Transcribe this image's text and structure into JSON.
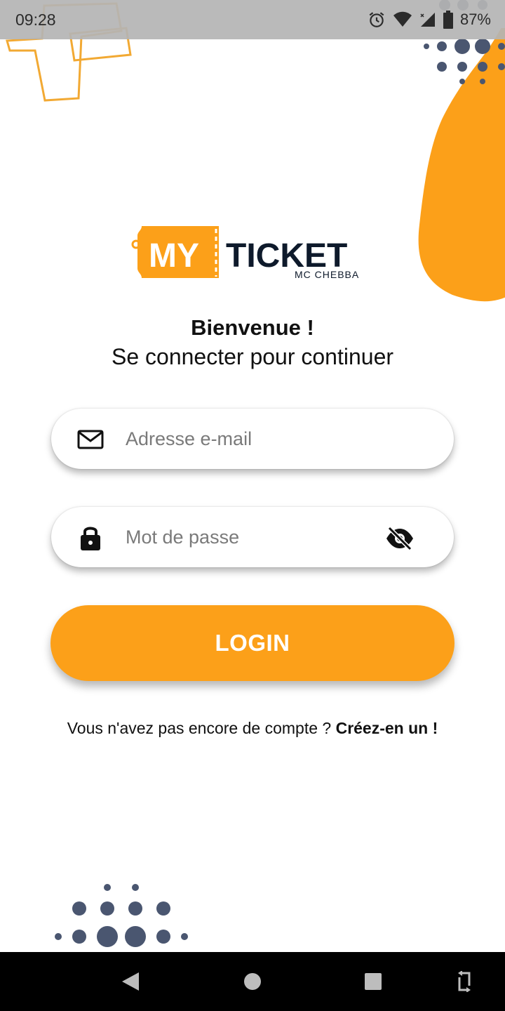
{
  "status_bar": {
    "time": "09:28",
    "battery": "87%",
    "icons": [
      "alarm-icon",
      "wifi-icon",
      "cell-signal-icon",
      "battery-icon"
    ]
  },
  "logo": {
    "brand_left": "MY",
    "brand_right": "TICKET",
    "tagline": "MC CHEBBA"
  },
  "welcome": {
    "title": "Bienvenue !",
    "subtitle": "Se connecter pour continuer"
  },
  "form": {
    "email": {
      "placeholder": "Adresse e-mail",
      "value": "",
      "icon": "mail-icon"
    },
    "password": {
      "placeholder": "Mot de passe",
      "value": "",
      "icon": "lock-icon",
      "toggle_icon": "eye-off-icon"
    },
    "login_label": "LOGIN"
  },
  "signup": {
    "prompt": "Vous n'avez pas encore de compte ? ",
    "link": "Créez-en un !"
  },
  "nav": {
    "buttons": [
      "back-icon",
      "home-icon",
      "recents-icon",
      "rotate-icon"
    ]
  },
  "colors": {
    "accent": "#fca019",
    "dots": "#4a5670",
    "text": "#111111",
    "logo_dark": "#0e1a2b"
  }
}
